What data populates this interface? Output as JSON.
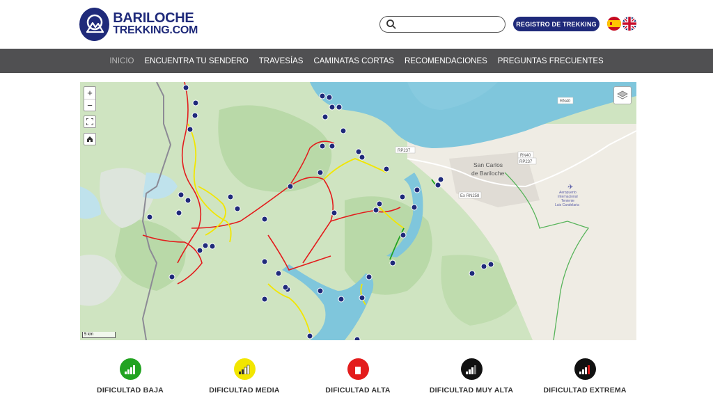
{
  "brand": {
    "line1": "BARILOCHE",
    "line2": "TREKKING.COM"
  },
  "search": {
    "placeholder": ""
  },
  "register_button": "REGISTRO DE TREKKING",
  "nav": [
    "INICIO",
    "ENCUENTRA TU SENDERO",
    "TRAVESÍAS",
    "CAMINATAS CORTAS",
    "RECOMENDACIONES",
    "PREGUNTAS FRECUENTES"
  ],
  "map": {
    "city_line1": "San Carlos",
    "city_line2": "de Bariloche",
    "route_rn40": "RN40",
    "route_rp237": "RP237",
    "route_rn40_b": "RN40",
    "route_rp237_b": "RP237",
    "route_exrn258": "Ex RN258",
    "airport_line1": "Aeropuerto",
    "airport_line2": "Internacional",
    "airport_line3": "Teniente",
    "airport_line4": "Luis Candelaria",
    "scale": "5 km"
  },
  "difficulty": [
    {
      "label": "DIFICULTAD BAJA",
      "color": "#22a321"
    },
    {
      "label": "DIFICULTAD MEDIA",
      "color": "#f2e600"
    },
    {
      "label": "DIFICULTAD ALTA",
      "color": "#e31d1d"
    },
    {
      "label": "DIFICULTAD MUY ALTA",
      "color": "#111111"
    },
    {
      "label": "DIFICULTAD EXTREMA",
      "color": "#111111"
    }
  ],
  "colors": {
    "brand": "#1f2a7a",
    "nav_bg": "#505052",
    "lake": "#7fc6dc"
  }
}
